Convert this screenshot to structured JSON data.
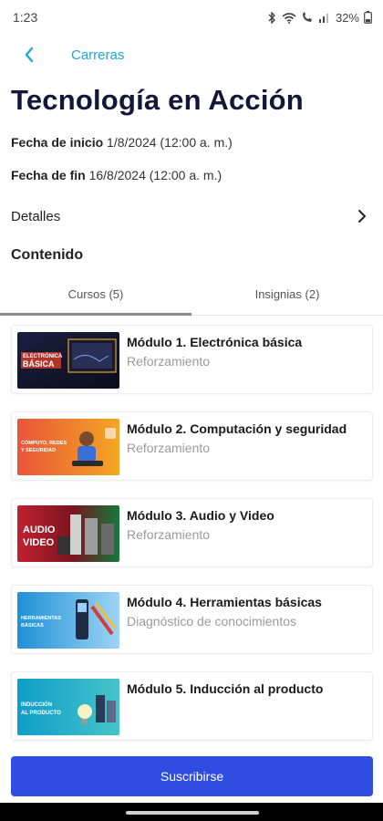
{
  "status_bar": {
    "time": "1:23",
    "battery": "32%"
  },
  "nav": {
    "back_label": "Carreras"
  },
  "title": "Tecnología en Acción",
  "dates": {
    "start_label": "Fecha de inicio",
    "start_value": "1/8/2024 (12:00 a. m.)",
    "end_label": "Fecha de fin",
    "end_value": "16/8/2024  (12:00 a. m.)"
  },
  "details_label": "Detalles",
  "content_title": "Contenido",
  "tabs": [
    {
      "label": "Cursos (5)",
      "active": true
    },
    {
      "label": "Insignias (2)",
      "active": false
    }
  ],
  "courses": [
    {
      "title": "Módulo 1. Electrónica básica",
      "subtitle": "Reforzamiento",
      "thumb_text": [
        "ELECTRÓNICA",
        "BÁSICA"
      ]
    },
    {
      "title": "Módulo 2. Computación y seguridad",
      "subtitle": "Reforzamiento",
      "thumb_text": [
        "CÓMPUTO, REDES",
        "Y SEGURIDAD"
      ]
    },
    {
      "title": "Módulo 3. Audio y Video",
      "subtitle": "Reforzamiento",
      "thumb_text": [
        "AUDIO",
        "VIDEO"
      ]
    },
    {
      "title": "Módulo 4. Herramientas básicas",
      "subtitle": "Diagnóstico de conocimientos",
      "thumb_text": [
        "HERRAMIENTAS",
        "BÁSICAS"
      ]
    },
    {
      "title": "Módulo 5. Inducción al producto",
      "subtitle": "",
      "thumb_text": [
        "INDUCCIÓN",
        "AL PRODUCTO"
      ]
    }
  ],
  "subscribe_label": "Suscribirse",
  "colors": {
    "accent": "#1aa9d6",
    "primary_button": "#2f4de0",
    "title": "#14163a"
  }
}
